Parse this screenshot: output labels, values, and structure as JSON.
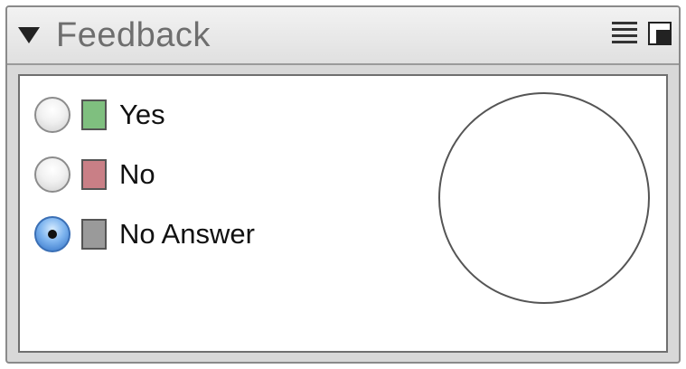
{
  "panel": {
    "title": "Feedback",
    "icons": {
      "disclosure": "disclosure-triangle-down-icon",
      "menu": "list-menu-icon",
      "float": "float-window-icon"
    }
  },
  "options": [
    {
      "label": "Yes",
      "color": "#7fbf7f",
      "selected": false
    },
    {
      "label": "No",
      "color": "#c97f86",
      "selected": false
    },
    {
      "label": "No Answer",
      "color": "#9a9a9a",
      "selected": true
    }
  ],
  "chart_data": {
    "type": "pie",
    "categories": [
      "Yes",
      "No",
      "No Answer"
    ],
    "values": [
      0,
      0,
      0
    ],
    "colors": [
      "#7fbf7f",
      "#c97f86",
      "#9a9a9a"
    ]
  }
}
